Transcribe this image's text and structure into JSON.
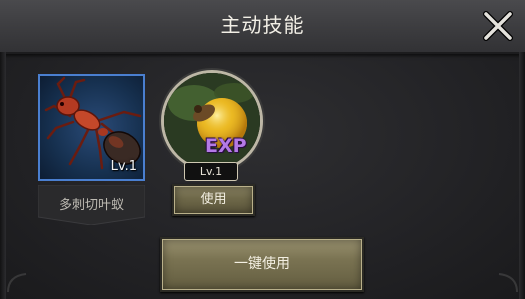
{
  "header": {
    "title": "主动技能"
  },
  "character": {
    "name": "多刺切叶蚁",
    "level": "Lv.1"
  },
  "item": {
    "label": "EXP",
    "level": "Lv.1"
  },
  "buttons": {
    "use": "使用",
    "use_all": "一键使用"
  },
  "colors": {
    "card_border": "#4a7fd0",
    "exp_text": "#b47ae6",
    "button_gold": "#7a7352"
  }
}
